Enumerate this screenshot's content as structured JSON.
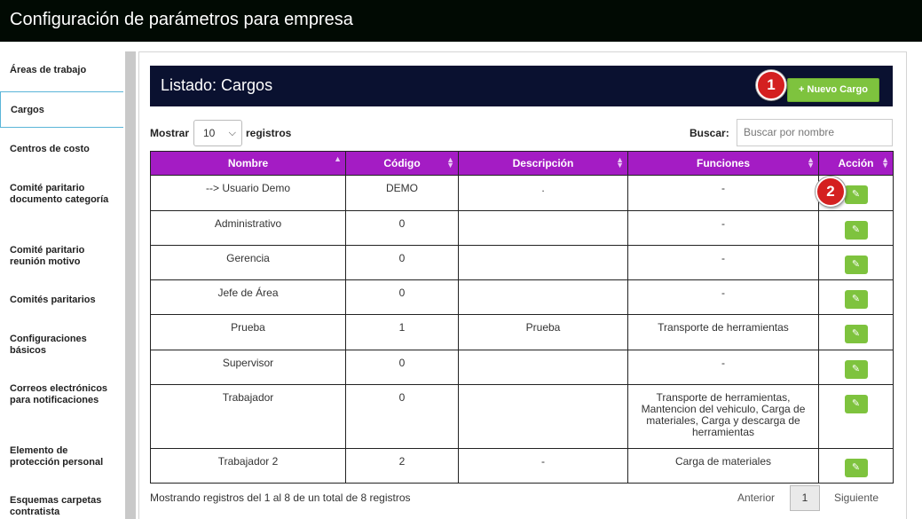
{
  "app": {
    "title": "Configuración de parámetros para empresa"
  },
  "sidebar": {
    "items": [
      {
        "label": "Áreas de trabajo",
        "active": false
      },
      {
        "label": "Cargos",
        "active": true
      },
      {
        "label": "Centros de costo",
        "active": false
      },
      {
        "label": "Comité paritario documento categoría",
        "active": false
      },
      {
        "label": "Comité paritario reunión motivo",
        "active": false
      },
      {
        "label": "Comités paritarios",
        "active": false
      },
      {
        "label": "Configuraciones básicos",
        "active": false
      },
      {
        "label": "Correos electrónicos para notificaciones",
        "active": false
      },
      {
        "label": "Elemento de protección personal",
        "active": false
      },
      {
        "label": "Esquemas carpetas contratista",
        "active": false
      }
    ]
  },
  "panel": {
    "title": "Listado: Cargos",
    "new_button_label": "+ Nuevo Cargo",
    "badge1": "1",
    "badge2": "2",
    "show_label": "Mostrar",
    "page_size": "10",
    "records_label": "registros",
    "search_label": "Buscar:",
    "search_placeholder": "Buscar por nombre"
  },
  "table": {
    "columns": [
      "Nombre",
      "Código",
      "Descripción",
      "Funciones",
      "Acción"
    ],
    "rows": [
      {
        "nombre": "--> Usuario Demo",
        "codigo": "DEMO",
        "descripcion": ".",
        "funciones": "-"
      },
      {
        "nombre": "Administrativo",
        "codigo": "0",
        "descripcion": "",
        "funciones": "-"
      },
      {
        "nombre": "Gerencia",
        "codigo": "0",
        "descripcion": "",
        "funciones": "-"
      },
      {
        "nombre": "Jefe de Área",
        "codigo": "0",
        "descripcion": "",
        "funciones": "-"
      },
      {
        "nombre": "Prueba",
        "codigo": "1",
        "descripcion": "Prueba",
        "funciones": "Transporte de herramientas"
      },
      {
        "nombre": "Supervisor",
        "codigo": "0",
        "descripcion": "",
        "funciones": "-"
      },
      {
        "nombre": "Trabajador",
        "codigo": "0",
        "descripcion": "",
        "funciones": "Transporte de herramientas, Mantencion del vehiculo, Carga de materiales, Carga y descarga de herramientas"
      },
      {
        "nombre": "Trabajador 2",
        "codigo": "2",
        "descripcion": "-",
        "funciones": "Carga de materiales"
      }
    ]
  },
  "footer": {
    "summary": "Mostrando registros del 1 al 8 de un total de 8 registros",
    "prev": "Anterior",
    "page": "1",
    "next": "Siguiente"
  },
  "colors": {
    "topbar": "#010a03",
    "header": "#0a1130",
    "table_header": "#a41cc4",
    "button_green": "#7ec33e",
    "badge_red": "#d42020"
  },
  "icons": {
    "edit": "pencil-icon",
    "sort": "sort-arrows-icon",
    "dropdown": "chevron-down-icon"
  }
}
